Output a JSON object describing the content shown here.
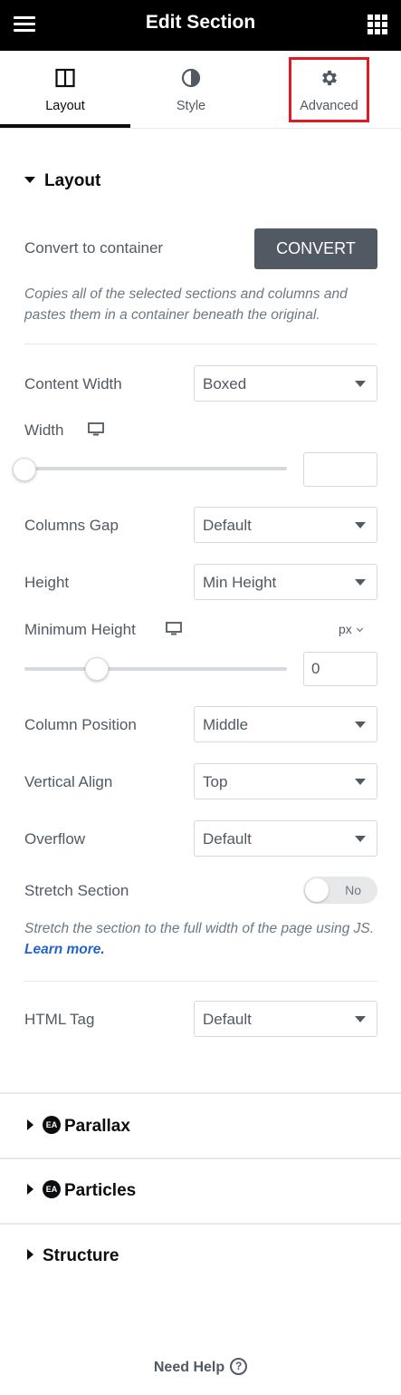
{
  "header": {
    "title": "Edit Section",
    "menu_icon": "hamburger-icon",
    "apps_icon": "grid-icon"
  },
  "tabs": [
    {
      "label": "Layout",
      "icon": "columns-icon",
      "active": true
    },
    {
      "label": "Style",
      "icon": "half-circle-icon",
      "active": false
    },
    {
      "label": "Advanced",
      "icon": "gear-icon",
      "active": false
    }
  ],
  "layout_section": {
    "title": "Layout",
    "convert": {
      "label": "Convert to container",
      "button": "CONVERT",
      "description": "Copies all of the selected sections and columns and pastes them in a container beneath the original."
    },
    "content_width": {
      "label": "Content Width",
      "value": "Boxed"
    },
    "width": {
      "label": "Width",
      "value": "",
      "slider_fraction": 0
    },
    "columns_gap": {
      "label": "Columns Gap",
      "value": "Default"
    },
    "height": {
      "label": "Height",
      "value": "Min Height"
    },
    "min_height": {
      "label": "Minimum Height",
      "unit": "px",
      "value": "0",
      "slider_fraction": 0.28
    },
    "column_position": {
      "label": "Column Position",
      "value": "Middle"
    },
    "vertical_align": {
      "label": "Vertical Align",
      "value": "Top"
    },
    "overflow": {
      "label": "Overflow",
      "value": "Default"
    },
    "stretch": {
      "label": "Stretch Section",
      "toggle": "No",
      "description_prefix": "Stretch the section to the full width of the page using JS.",
      "link": "Learn more."
    },
    "html_tag": {
      "label": "HTML Tag",
      "value": "Default"
    }
  },
  "collapsed_sections": [
    {
      "title": "Parallax",
      "badge": "EA"
    },
    {
      "title": "Particles",
      "badge": "EA"
    },
    {
      "title": "Structure",
      "badge": ""
    }
  ],
  "footer": {
    "help": "Need Help",
    "help_icon": "?"
  },
  "colors": {
    "header_bg": "#000000",
    "highlight": "#e01b24",
    "button": "#515962",
    "link": "#2563c9"
  }
}
